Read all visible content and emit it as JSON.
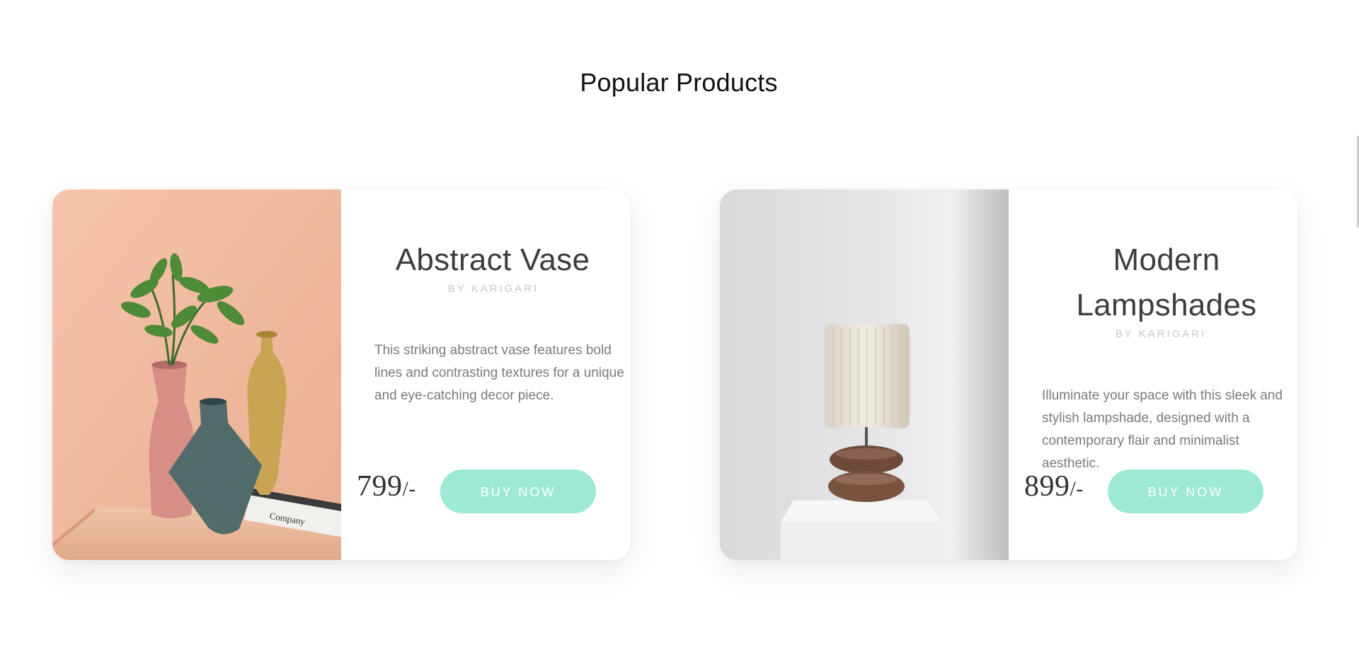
{
  "section": {
    "title": "Popular Products"
  },
  "products": [
    {
      "name": "Abstract Vase",
      "brand": "BY KARIGARI",
      "description": "This striking abstract vase features bold lines and contrasting textures for a unique and eye-catching decor piece.",
      "price": "799",
      "price_suffix": "/-",
      "button_label": "BUY NOW",
      "image_text": "Company"
    },
    {
      "name": "Modern Lampshades",
      "brand": "BY KARIGARI",
      "description": "Illuminate your space with this sleek and stylish lampshade, designed with a contemporary flair and minimalist aesthetic.",
      "price": "899",
      "price_suffix": "/-",
      "button_label": "BUY NOW"
    }
  ],
  "colors": {
    "accent": "#9ee9d5",
    "title": "#111111",
    "heading": "#3d3d3d",
    "muted": "#7a7a7a",
    "brand": "#c8c8c8"
  }
}
